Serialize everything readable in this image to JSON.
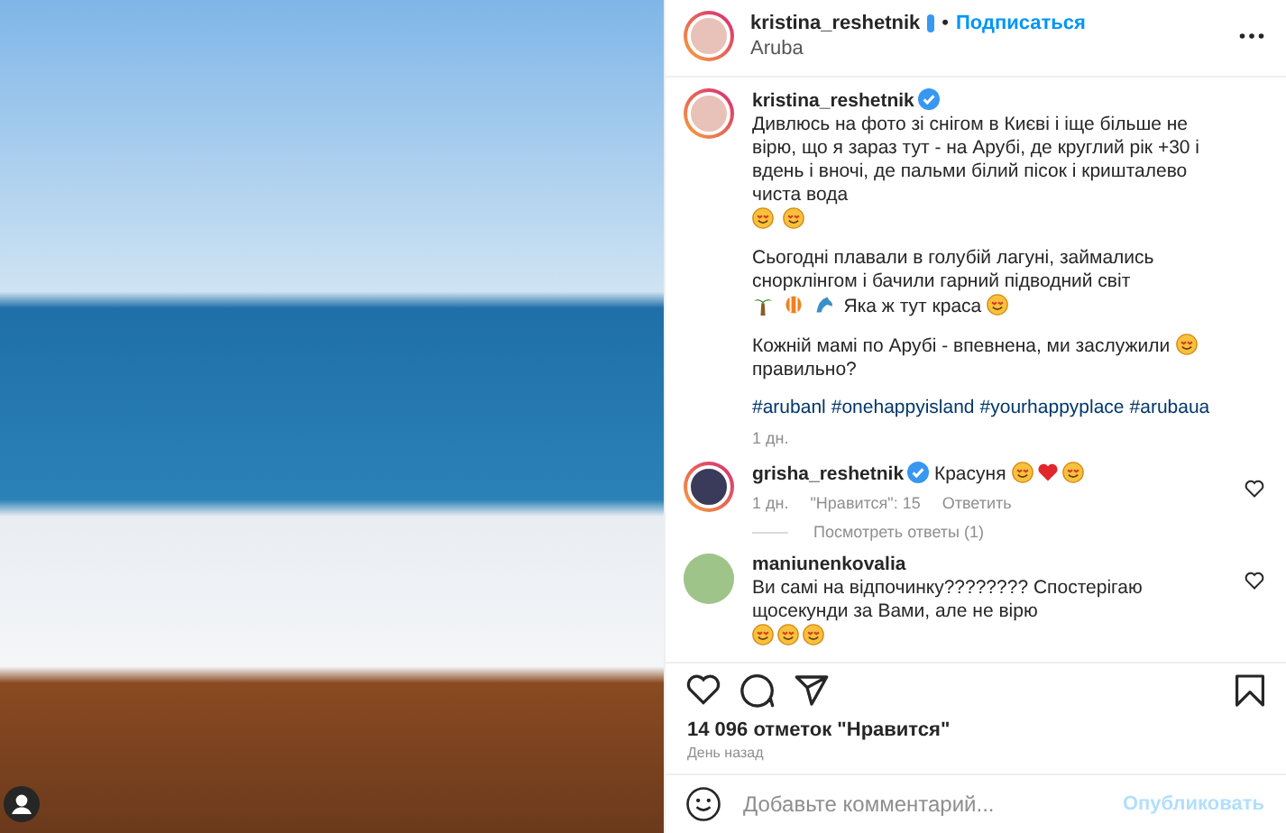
{
  "header": {
    "username": "kristina_reshetnik",
    "separator": "•",
    "follow": "Подписаться",
    "location": "Aruba"
  },
  "caption": {
    "username": "kristina_reshetnik",
    "paragraphs": [
      [
        {
          "kind": "text",
          "text": "Дивлюсь на фото зі снігом в Києві і іще більше не вірю, що я зараз тут - на Арубі, де круглий рік +30 і вдень і вночі, де пальми білий пісок і кришталево чиста вода"
        },
        {
          "kind": "face"
        },
        {
          "kind": "face"
        }
      ],
      [
        {
          "kind": "text",
          "text": "Сьогодні плавали в голубій лагуні, займались снорклінгом і бачили гарний підводний світ"
        },
        {
          "kind": "palm"
        },
        {
          "kind": "fish"
        },
        {
          "kind": "dolphin"
        },
        {
          "kind": "text",
          "text": "Яка ж тут краса"
        },
        {
          "kind": "face"
        }
      ],
      [
        {
          "kind": "text",
          "text": "Кожній мамі по Арубі - впевнена, ми заслужили"
        },
        {
          "kind": "face"
        },
        {
          "kind": "text",
          "text": "правильно?"
        }
      ],
      [
        {
          "kind": "link",
          "text": "#arubanl"
        },
        {
          "kind": "link",
          "text": "#onehappyisland"
        },
        {
          "kind": "link",
          "text": "#yourhappyplace"
        },
        {
          "kind": "link",
          "text": "#arubaua"
        }
      ]
    ],
    "time": "1 дн."
  },
  "comments": [
    {
      "username": "grisha_reshetnik",
      "verified": true,
      "parts": [
        {
          "kind": "text",
          "text": "Красуня"
        },
        {
          "kind": "face"
        },
        {
          "kind": "heart"
        },
        {
          "kind": "face"
        }
      ],
      "time": "1 дн.",
      "likes": "\"Нравится\": 15",
      "reply": "Ответить",
      "view_replies": "Посмотреть ответы (1)"
    },
    {
      "username": "maniunenkovalia",
      "verified": false,
      "parts": [
        {
          "kind": "text",
          "text": "Ви самі на відпочинку???????? Спостерігаю щосекунди за Вами, але не вірю"
        },
        {
          "kind": "face"
        },
        {
          "kind": "face"
        },
        {
          "kind": "face"
        }
      ]
    }
  ],
  "likes": "14 096 отметок \"Нравится\"",
  "posted": "День назад",
  "comment_box": {
    "placeholder": "Добавьте комментарий...",
    "submit": "Опубликовать"
  }
}
